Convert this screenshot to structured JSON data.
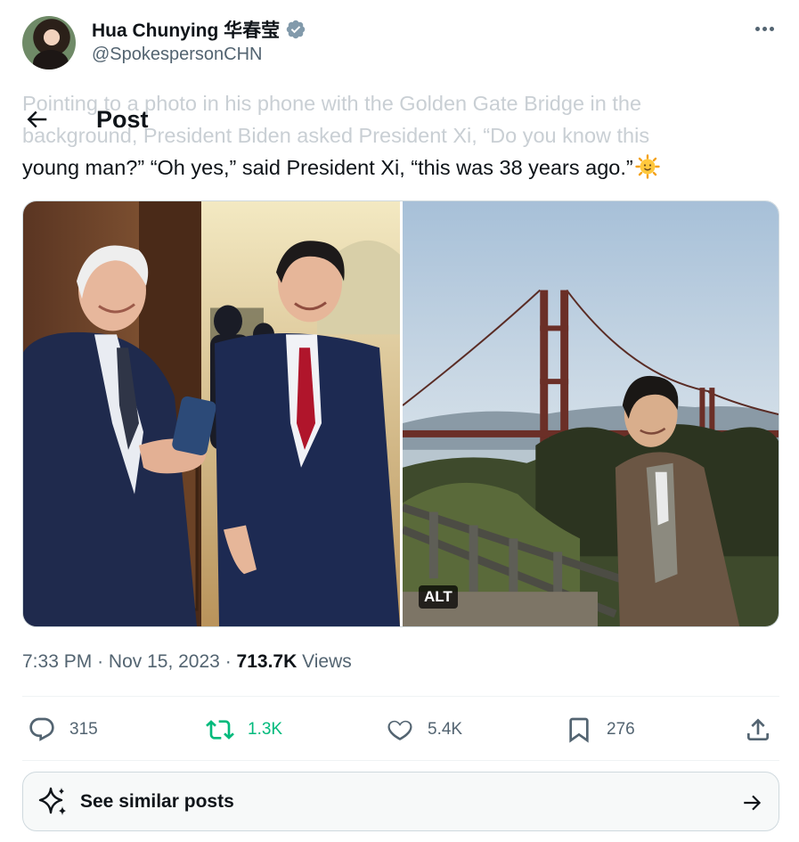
{
  "author": {
    "name": "Hua Chunying 华春莹",
    "handle": "@SpokespersonCHN"
  },
  "header": {
    "title": "Post"
  },
  "post": {
    "text_faded": "Pointing to a photo in his phone with the Golden Gate Bridge in the background, President Biden asked President Xi, “Do you know this",
    "text_visible": "young man?” “Oh yes,” said President Xi, “this was 38 years ago.”",
    "emoji": "sun-with-face-icon",
    "media": {
      "alt_badge": "ALT",
      "photos": [
        "biden-xi-photo",
        "golden-gate-photo"
      ]
    },
    "time": "7:33 PM",
    "date": "Nov 15, 2023",
    "views_count": "713.7K",
    "views_label": "Views"
  },
  "actions": {
    "replies": "315",
    "reposts": "1.3K",
    "likes": "5.4K",
    "bookmarks": "276"
  },
  "similar": {
    "label": "See similar posts"
  },
  "colors": {
    "text": "#0f1419",
    "muted": "#536471",
    "repost_green": "#00ba7c",
    "verified_badge": "#829aab",
    "border": "#cfd9de"
  }
}
